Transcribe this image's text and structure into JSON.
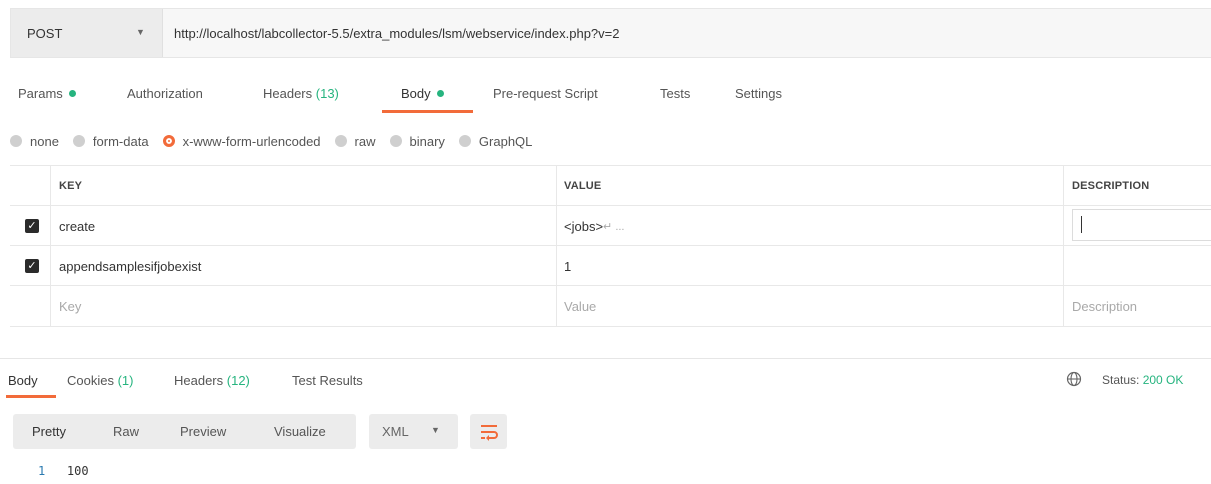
{
  "request": {
    "method": "POST",
    "url": "http://localhost/labcollector-5.5/extra_modules/lsm/webservice/index.php?v=2"
  },
  "request_tabs": {
    "params": "Params",
    "authorization": "Authorization",
    "headers": "Headers",
    "headers_count": "(13)",
    "body": "Body",
    "pre_request": "Pre-request Script",
    "tests": "Tests",
    "settings": "Settings"
  },
  "body_types": {
    "none": "none",
    "form_data": "form-data",
    "urlencoded": "x-www-form-urlencoded",
    "raw": "raw",
    "binary": "binary",
    "graphql": "GraphQL",
    "selected": "x-www-form-urlencoded"
  },
  "params_table": {
    "headers": {
      "key": "KEY",
      "value": "VALUE",
      "description": "DESCRIPTION"
    },
    "rows": [
      {
        "key": "create",
        "value": "<jobs>",
        "value_suffix": " ↵ ...",
        "description": ""
      },
      {
        "key": "appendsamplesifjobexist",
        "value": "1",
        "description": ""
      }
    ],
    "placeholders": {
      "key": "Key",
      "value": "Value",
      "description": "Description"
    }
  },
  "response_tabs": {
    "body": "Body",
    "cookies": "Cookies",
    "cookies_count": "(1)",
    "headers": "Headers",
    "headers_count": "(12)",
    "test_results": "Test Results"
  },
  "status": {
    "label": "Status:",
    "value": "200 OK"
  },
  "view_modes": {
    "pretty": "Pretty",
    "raw": "Raw",
    "preview": "Preview",
    "visualize": "Visualize",
    "format": "XML"
  },
  "response_body": {
    "line_number": "1",
    "content": "100"
  },
  "colors": {
    "accent": "#f26b3a",
    "success": "#26b47f"
  },
  "icons": {
    "method_dropdown": "chevron-down-icon",
    "format_dropdown": "chevron-down-icon",
    "wrap": "wrap-lines-icon",
    "globe": "globe-icon"
  }
}
